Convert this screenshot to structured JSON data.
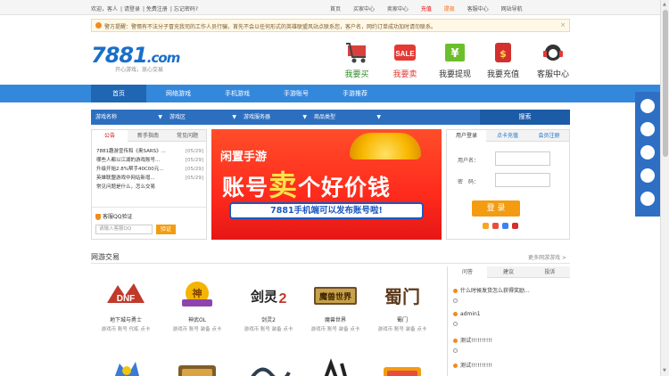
{
  "topbar": {
    "greeting": "欢迎，客人",
    "login": "请登录",
    "register": "免费注册",
    "forgot": "忘记密码?",
    "links": [
      "首页",
      "买家中心",
      "卖家中心",
      "充值",
      "提现",
      "客服中心",
      "网站导航"
    ]
  },
  "notice": {
    "text": "警方提醒：警惕有不法分子冒充我司的工作人员行骗，首先不会以任何形式的英雄联盟风站点联系您，客户名，网约订单成功加时请勿联系。"
  },
  "logo": {
    "text": "7881",
    "suffix": ".com",
    "slogan": "开心游戏，放心交易"
  },
  "shortcuts": [
    "我要买",
    "我要卖",
    "我要提现",
    "我要充值",
    "客服中心"
  ],
  "nav": [
    "首页",
    "网络游戏",
    "手机游戏",
    "手游账号",
    "手游推荐"
  ],
  "search": {
    "selects": [
      "游戏名称",
      "游戏区",
      "游戏服务器",
      "商品类型"
    ],
    "button": "搜索"
  },
  "news": {
    "tabs": [
      "公告",
      "新手指南",
      "常见问题"
    ],
    "items": [
      {
        "title": "7881趣游宣传和《奥SARS》...",
        "date": "[05/29]"
      },
      {
        "title": "哪些人都以江湖的游戏账号...",
        "date": "[05/29]"
      },
      {
        "title": "升级开始2.8%帮手40C00元...",
        "date": "[05/29]"
      },
      {
        "title": "英雄联盟游戏中网站新增...",
        "date": "[05/29]"
      },
      {
        "title": "常见问题是什么，怎么交易",
        "date": "[05/29]"
      }
    ],
    "qq_title": "客服QQ验证",
    "qq_placeholder": "请输入客服QQ",
    "qq_button": "验证"
  },
  "banner": {
    "line1": "闲置手游",
    "line2_pre": "账号",
    "line2_hl": "卖",
    "line2_post": "个好价钱",
    "strip": "7881手机端可以发布账号啦!"
  },
  "login": {
    "tabs": [
      "用户登录",
      "点卡充值",
      "会员注册"
    ],
    "user_label": "用户名：",
    "pass_label": "密　码：",
    "button": "登 录"
  },
  "section": {
    "title": "网游交易",
    "more": "更多网游游戏 >"
  },
  "games": [
    {
      "name": "地下城与勇士",
      "tags": "游戏币 账号 代练 点卡"
    },
    {
      "name": "神武OL",
      "tags": "游戏币 账号 装备 点卡"
    },
    {
      "name": "剑灵2",
      "tags": "游戏币 账号 装备 点卡"
    },
    {
      "name": "魔兽世界",
      "tags": "游戏币 账号 装备 点卡"
    },
    {
      "name": "蜀门",
      "tags": "游戏币 账号 装备 点卡"
    },
    {
      "name": "",
      "tags": ""
    },
    {
      "name": "",
      "tags": ""
    },
    {
      "name": "",
      "tags": ""
    },
    {
      "name": "",
      "tags": ""
    },
    {
      "name": "",
      "tags": ""
    }
  ],
  "qa": {
    "tabs": [
      "问答",
      "建议",
      "投诉"
    ],
    "items": [
      {
        "q": "什么时候发货怎么获得奖励...",
        "a": ""
      },
      {
        "q": "admin1",
        "a": ""
      },
      {
        "q": "测试!!!!!!!!!!",
        "a": ""
      },
      {
        "q": "测试!!!!!!!!!!",
        "a": ""
      }
    ]
  },
  "colors": {
    "nav": "#3488dc",
    "accent": "#f39c12",
    "brand": "#1a6fc9"
  }
}
